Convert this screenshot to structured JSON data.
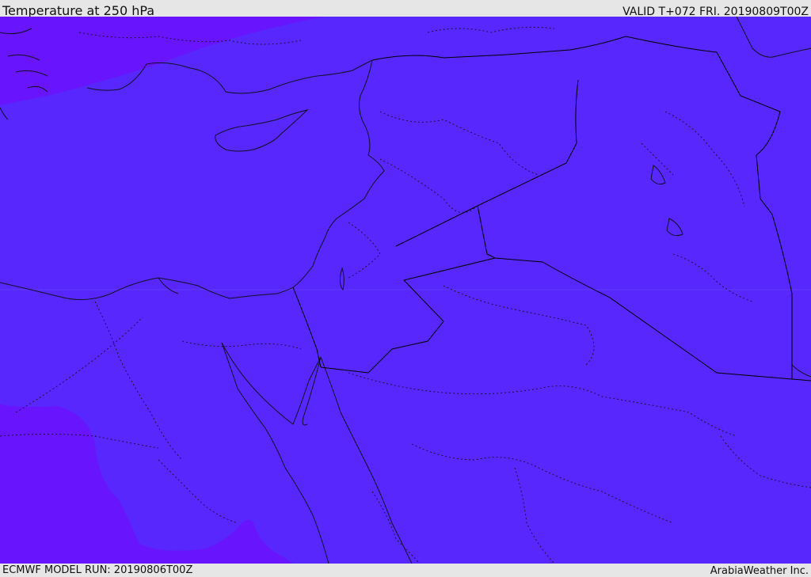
{
  "header": {
    "title": "Temperature at 250 hPa",
    "valid": "VALID T+072 FRI. 20190809T00Z"
  },
  "footer": {
    "model_run": "ECMWF MODEL RUN: 20190806T00Z",
    "brand": "ArabiaWeather Inc."
  },
  "map": {
    "colors": {
      "main_fill": "#5727fe",
      "cold_fill": "#6814fc",
      "coast_line": "#111122",
      "border_line": "#000000"
    }
  }
}
